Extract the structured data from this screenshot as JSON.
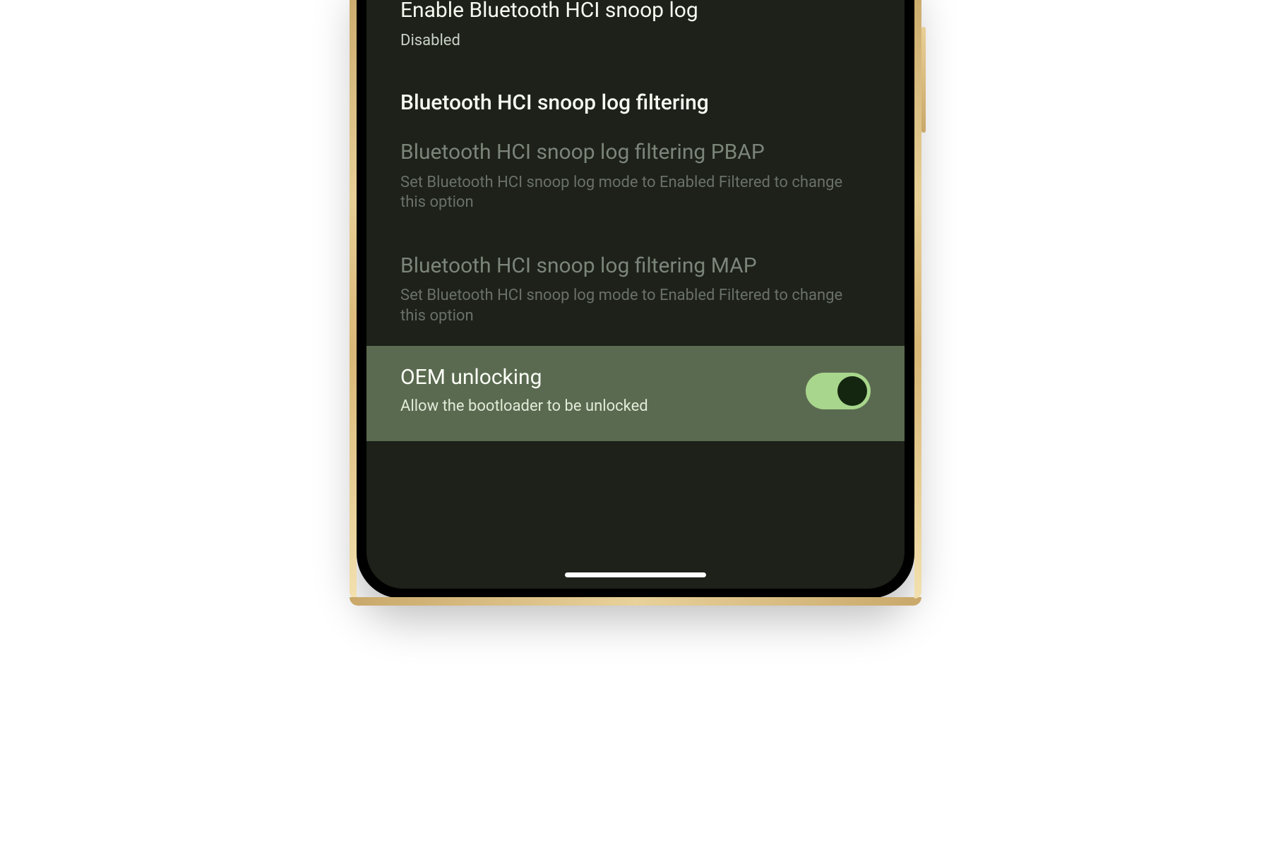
{
  "settings": {
    "bt_snoop": {
      "title": "Enable Bluetooth HCI snoop log",
      "value": "Disabled"
    },
    "section_filtering_header": "Bluetooth HCI snoop log filtering",
    "filter_pbap": {
      "title": "Bluetooth HCI snoop log filtering PBAP",
      "sub": "Set Bluetooth HCI snoop log mode to Enabled Filtered to change this option"
    },
    "filter_map": {
      "title": "Bluetooth HCI snoop log filtering MAP",
      "sub": "Set Bluetooth HCI snoop log mode to Enabled Filtered to change this option"
    },
    "oem_unlock": {
      "title": "OEM unlocking",
      "sub": "Allow the bootloader to be unlocked",
      "enabled": true
    }
  }
}
